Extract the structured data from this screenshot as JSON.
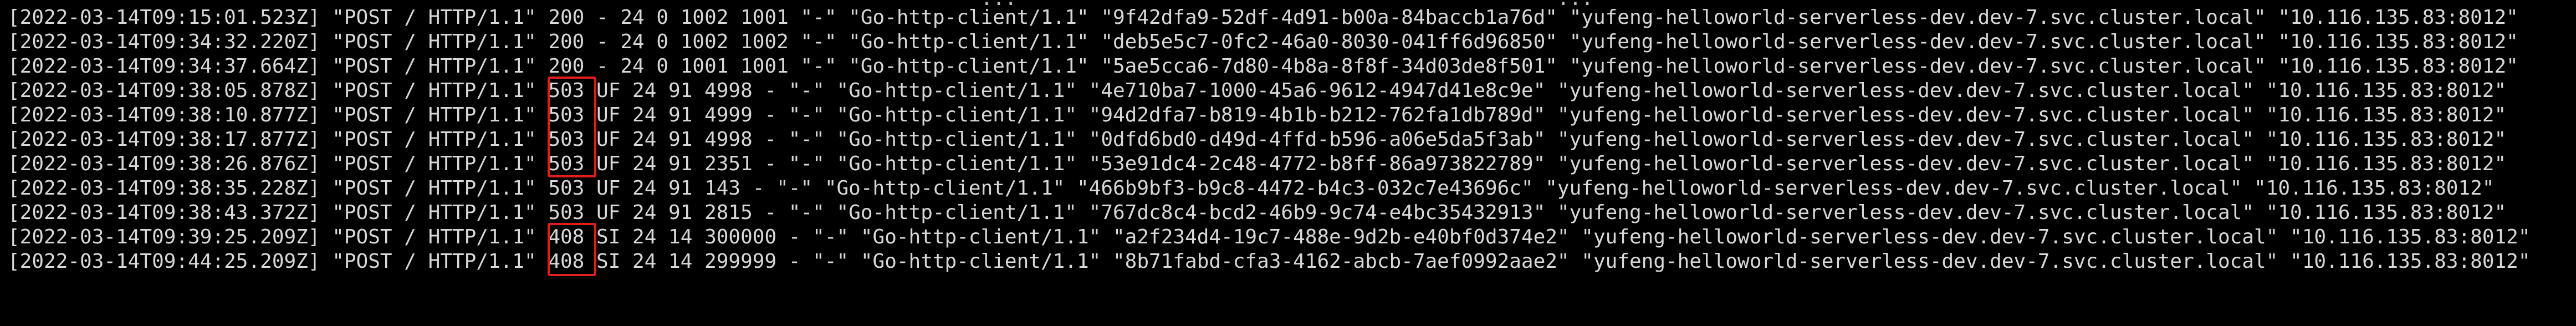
{
  "terminal": {
    "partial_line": "                                                                                 ...                                             ...",
    "lines": [
      "[2022-03-14T09:15:01.523Z] \"POST / HTTP/1.1\" 200 - 24 0 1002 1001 \"-\" \"Go-http-client/1.1\" \"9f42dfa9-52df-4d91-b00a-84baccb1a76d\" \"yufeng-helloworld-serverless-dev.dev-7.svc.cluster.local\" \"10.116.135.83:8012\"",
      "[2022-03-14T09:34:32.220Z] \"POST / HTTP/1.1\" 200 - 24 0 1002 1002 \"-\" \"Go-http-client/1.1\" \"deb5e5c7-0fc2-46a0-8030-041ff6d96850\" \"yufeng-helloworld-serverless-dev.dev-7.svc.cluster.local\" \"10.116.135.83:8012\"",
      "[2022-03-14T09:34:37.664Z] \"POST / HTTP/1.1\" 200 - 24 0 1001 1001 \"-\" \"Go-http-client/1.1\" \"5ae5cca6-7d80-4b8a-8f8f-34d03de8f501\" \"yufeng-helloworld-serverless-dev.dev-7.svc.cluster.local\" \"10.116.135.83:8012\"",
      "[2022-03-14T09:38:05.878Z] \"POST / HTTP/1.1\" 503 UF 24 91 4998 - \"-\" \"Go-http-client/1.1\" \"4e710ba7-1000-45a6-9612-4947d41e8c9e\" \"yufeng-helloworld-serverless-dev.dev-7.svc.cluster.local\" \"10.116.135.83:8012\"",
      "[2022-03-14T09:38:10.877Z] \"POST / HTTP/1.1\" 503 UF 24 91 4999 - \"-\" \"Go-http-client/1.1\" \"94d2dfa7-b819-4b1b-b212-762fa1db789d\" \"yufeng-helloworld-serverless-dev.dev-7.svc.cluster.local\" \"10.116.135.83:8012\"",
      "[2022-03-14T09:38:17.877Z] \"POST / HTTP/1.1\" 503 UF 24 91 4998 - \"-\" \"Go-http-client/1.1\" \"0dfd6bd0-d49d-4ffd-b596-a06e5da5f3ab\" \"yufeng-helloworld-serverless-dev.dev-7.svc.cluster.local\" \"10.116.135.83:8012\"",
      "[2022-03-14T09:38:26.876Z] \"POST / HTTP/1.1\" 503 UF 24 91 2351 - \"-\" \"Go-http-client/1.1\" \"53e91dc4-2c48-4772-b8ff-86a973822789\" \"yufeng-helloworld-serverless-dev.dev-7.svc.cluster.local\" \"10.116.135.83:8012\"",
      "[2022-03-14T09:38:35.228Z] \"POST / HTTP/1.1\" 503 UF 24 91 143 - \"-\" \"Go-http-client/1.1\" \"466b9bf3-b9c8-4472-b4c3-032c7e43696c\" \"yufeng-helloworld-serverless-dev.dev-7.svc.cluster.local\" \"10.116.135.83:8012\"",
      "[2022-03-14T09:38:43.372Z] \"POST / HTTP/1.1\" 503 UF 24 91 2815 - \"-\" \"Go-http-client/1.1\" \"767dc8c4-bcd2-46b9-9c74-e4bc35432913\" \"yufeng-helloworld-serverless-dev.dev-7.svc.cluster.local\" \"10.116.135.83:8012\"",
      "[2022-03-14T09:39:25.209Z] \"POST / HTTP/1.1\" 408 SI 24 14 300000 - \"-\" \"Go-http-client/1.1\" \"a2f234d4-19c7-488e-9d2b-e40bf0d374e2\" \"yufeng-helloworld-serverless-dev.dev-7.svc.cluster.local\" \"10.116.135.83:8012\"",
      "[2022-03-14T09:44:25.209Z] \"POST / HTTP/1.1\" 408 SI 24 14 299999 - \"-\" \"Go-http-client/1.1\" \"8b71fabd-cfa3-4162-abcb-7aef0992aae2\" \"yufeng-helloworld-serverless-dev.dev-7.svc.cluster.local\" \"10.116.135.83:8012\""
    ]
  },
  "colors": {
    "background": "#000000",
    "text": "#d8d8d8",
    "highlight": "#e01d1d"
  }
}
